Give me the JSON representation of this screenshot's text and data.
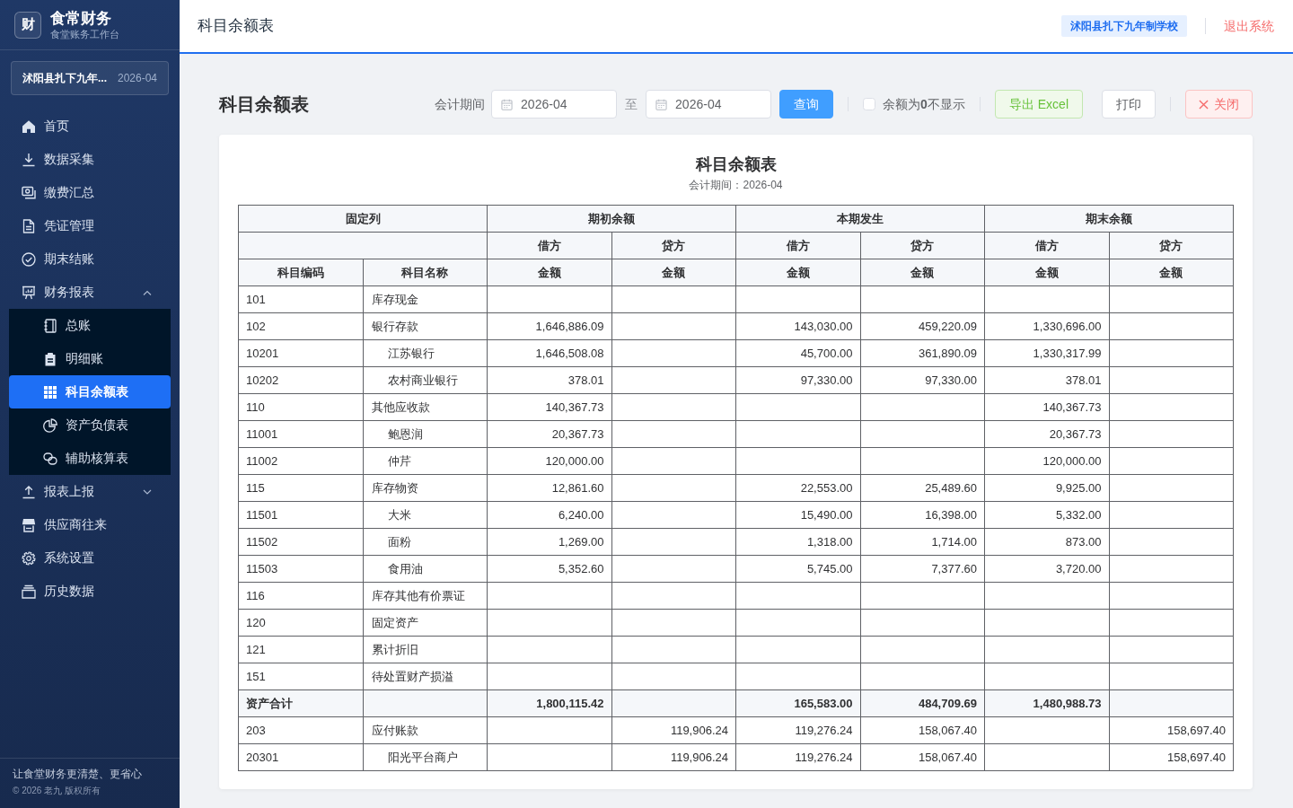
{
  "sidebar": {
    "brand": {
      "logo": "财",
      "title": "食常财务",
      "subtitle": "食堂账务工作台"
    },
    "org_selector": {
      "name": "沭阳县扎下九年...",
      "period": "2026-04"
    },
    "items": [
      {
        "label": "首页",
        "selected": false
      },
      {
        "label": "数据采集",
        "selected": false
      },
      {
        "label": "缴费汇总",
        "selected": false
      },
      {
        "label": "凭证管理",
        "selected": false
      },
      {
        "label": "期末结账",
        "selected": false
      },
      {
        "label": "财务报表",
        "selected": false,
        "expanded": true,
        "children": [
          {
            "label": "总账",
            "selected": false
          },
          {
            "label": "明细账",
            "selected": false
          },
          {
            "label": "科目余额表",
            "selected": true
          },
          {
            "label": "资产负债表",
            "selected": false
          },
          {
            "label": "辅助核算表",
            "selected": false
          }
        ]
      },
      {
        "label": "报表上报",
        "selected": false,
        "expanded": false
      },
      {
        "label": "供应商往来",
        "selected": false
      },
      {
        "label": "系统设置",
        "selected": false
      },
      {
        "label": "历史数据",
        "selected": false
      }
    ],
    "footer": {
      "slogan": "让食堂财务更清楚、更省心",
      "copyright": "© 2026 老九 版权所有"
    }
  },
  "header": {
    "title": "科目余额表",
    "org_badge": "沭阳县扎下九年制学校",
    "logout": "退出系统"
  },
  "toolbar": {
    "title": "科目余额表",
    "period_label": "会计期间",
    "period_from": "2026-04",
    "range_separator": "至",
    "period_to": "2026-04",
    "query_button": "查询",
    "hide_zero": {
      "label": "余额为**0**不显示",
      "checked": false
    },
    "buttons": [
      {
        "label": "导出 Excel",
        "kind": "export"
      },
      {
        "label": "打印",
        "kind": "print"
      },
      {
        "label": "关闭",
        "kind": "close"
      }
    ]
  },
  "report": {
    "title": "科目余额表",
    "subtitle": "会计期间：2026-04",
    "table": {
      "groups": [
        "固定列",
        "期初余额",
        "本期发生",
        "期末余额"
      ],
      "sides": [
        "借方",
        "贷方",
        "借方",
        "贷方",
        "借方",
        "贷方"
      ],
      "columns": [
        "科目编码",
        "科目名称",
        "金额",
        "金额",
        "金额",
        "金额",
        "金额",
        "金额"
      ],
      "rows": [
        {
          "kind": "account",
          "code": "101",
          "name": "库存现金"
        },
        {
          "kind": "account",
          "code": "102",
          "name": "银行存款",
          "opening_debit": "1,646,886.09",
          "period_debit": "143,030.00",
          "period_credit": "459,220.09",
          "closing_debit": "1,330,696.00",
          "children": [
            {
              "kind": "account",
              "code": "10201",
              "name": "江苏银行",
              "opening_debit": "1,646,508.08",
              "period_debit": "45,700.00",
              "period_credit": "361,890.09",
              "closing_debit": "1,330,317.99"
            },
            {
              "kind": "account",
              "code": "10202",
              "name": "农村商业银行",
              "opening_debit": "378.01",
              "period_debit": "97,330.00",
              "period_credit": "97,330.00",
              "closing_debit": "378.01"
            }
          ]
        },
        {
          "kind": "account",
          "code": "110",
          "name": "其他应收款",
          "opening_debit": "140,367.73",
          "closing_debit": "140,367.73",
          "children": [
            {
              "kind": "account",
              "code": "11001",
              "name": "鲍恩润",
              "opening_debit": "20,367.73",
              "closing_debit": "20,367.73"
            },
            {
              "kind": "account",
              "code": "11002",
              "name": "仲芹",
              "opening_debit": "120,000.00",
              "closing_debit": "120,000.00"
            }
          ]
        },
        {
          "kind": "account",
          "code": "115",
          "name": "库存物资",
          "opening_debit": "12,861.60",
          "period_debit": "22,553.00",
          "period_credit": "25,489.60",
          "closing_debit": "9,925.00",
          "children": [
            {
              "kind": "account",
              "code": "11501",
              "name": "大米",
              "opening_debit": "6,240.00",
              "period_debit": "15,490.00",
              "period_credit": "16,398.00",
              "closing_debit": "5,332.00"
            },
            {
              "kind": "account",
              "code": "11502",
              "name": "面粉",
              "opening_debit": "1,269.00",
              "period_debit": "1,318.00",
              "period_credit": "1,714.00",
              "closing_debit": "873.00"
            },
            {
              "kind": "account",
              "code": "11503",
              "name": "食用油",
              "opening_debit": "5,352.60",
              "period_debit": "5,745.00",
              "period_credit": "7,377.60",
              "closing_debit": "3,720.00"
            }
          ]
        },
        {
          "kind": "account",
          "code": "116",
          "name": "库存其他有价票证"
        },
        {
          "kind": "account",
          "code": "120",
          "name": "固定资产"
        },
        {
          "kind": "account",
          "code": "121",
          "name": "累计折旧"
        },
        {
          "kind": "account",
          "code": "151",
          "name": "待处置财产损溢"
        },
        {
          "kind": "total",
          "label": "资产合计",
          "opening_debit": "1,800,115.42",
          "period_debit": "165,583.00",
          "period_credit": "484,709.69",
          "closing_debit": "1,480,988.73"
        },
        {
          "kind": "account",
          "code": "203",
          "name": "应付账款",
          "opening_credit": "119,906.24",
          "period_debit": "119,276.24",
          "period_credit": "158,067.40",
          "closing_credit": "158,697.40",
          "children": [
            {
              "kind": "account",
              "code": "20301",
              "name": "阳光平台商户",
              "opening_credit": "119,906.24",
              "period_debit": "119,276.24",
              "period_credit": "158,067.40",
              "closing_credit": "158,697.40"
            }
          ]
        }
      ]
    }
  }
}
